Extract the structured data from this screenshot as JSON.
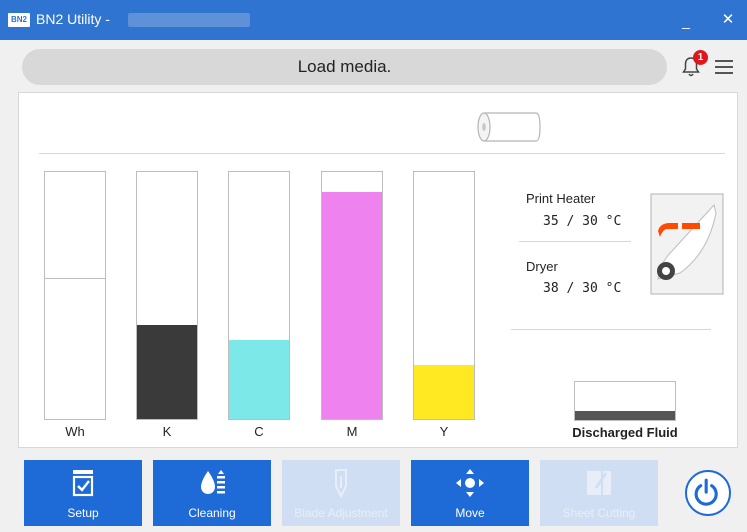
{
  "window": {
    "logo_text": "BN2",
    "title": "BN2 Utility -",
    "minimize_glyph": "_",
    "close_glyph": "✕"
  },
  "status": {
    "message": "Load media.",
    "notification_count": "1"
  },
  "ink": [
    {
      "label": "Wh",
      "level": 0.57,
      "color": "#ffffff"
    },
    {
      "label": "K",
      "level": 0.38,
      "color": "#3a3a3a"
    },
    {
      "label": "C",
      "level": 0.32,
      "color": "#7de8e8"
    },
    {
      "label": "M",
      "level": 0.92,
      "color": "#ee82ee"
    },
    {
      "label": "Y",
      "level": 0.22,
      "color": "#ffe923"
    }
  ],
  "heaters": {
    "print_heater_label": "Print Heater",
    "print_heater_value": "35 / 30 °C",
    "dryer_label": "Dryer",
    "dryer_value": "38 / 30 °C"
  },
  "discharged_fluid": {
    "label": "Discharged Fluid",
    "level": 0.25
  },
  "buttons": {
    "setup": "Setup",
    "cleaning": "Cleaning",
    "blade_adjustment": "Blade Adjustment",
    "move": "Move",
    "sheet_cutting": "Sheet Cutting"
  },
  "colors": {
    "accent": "#1e6ad6",
    "titlebar": "#2f74d0",
    "disabled_button": "#cfdef3",
    "badge": "#e0161c",
    "heater_indicator": "#ff4a00"
  },
  "icons": {
    "notification": "bell-icon",
    "menu": "hamburger-icon",
    "power": "power-icon"
  }
}
